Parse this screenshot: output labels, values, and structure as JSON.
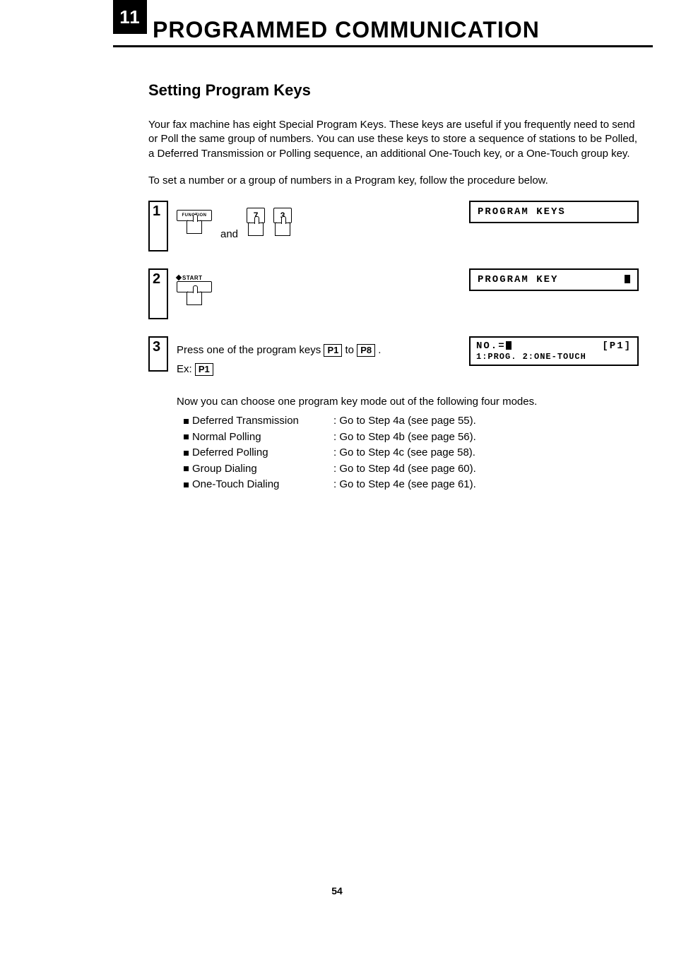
{
  "chapter": {
    "number": "11",
    "title": "PROGRAMMED COMMUNICATION"
  },
  "section_title": "Setting Program Keys",
  "intro_para": "Your fax machine has eight Special Program Keys. These keys are useful if you frequently need to send or Poll the same group of numbers. You can use these keys to store a sequence of stations to be Polled, a Deferred Transmission or Polling sequence, an additional One-Touch key, or a One-Touch group key.",
  "intro_para2": "To set a number or a group of numbers in a Program key, follow the procedure below.",
  "steps": {
    "s1": {
      "num": "1",
      "btn_function": "FUNCTION",
      "and": "and",
      "key7": "7",
      "key3": "3",
      "display": "PROGRAM KEYS"
    },
    "s2": {
      "num": "2",
      "btn_start": "START",
      "display": "PROGRAM KEY"
    },
    "s3": {
      "num": "3",
      "text_a": "Press one of the program keys ",
      "key_p1": "P1",
      "text_b": " to ",
      "key_p8": "P8",
      "text_c": " .",
      "ex_label": "Ex: ",
      "ex_key": "P1",
      "display_l1_a": "NO.=",
      "display_l1_b": "[P1]",
      "display_l2": "1:PROG. 2:ONE-TOUCH"
    }
  },
  "modes_intro": "Now you can choose one program key mode out of the following four modes.",
  "modes": [
    {
      "label": "Deferred Transmission",
      "dest": ": Go to Step 4a (see page 55)."
    },
    {
      "label": "Normal Polling",
      "dest": ": Go to Step 4b (see page 56)."
    },
    {
      "label": "Deferred Polling",
      "dest": ": Go to Step 4c (see page 58)."
    },
    {
      "label": "Group Dialing",
      "dest": ": Go to Step 4d (see page 60)."
    },
    {
      "label": "One-Touch Dialing",
      "dest": ": Go to Step 4e (see page 61)."
    }
  ],
  "page_number": "54"
}
